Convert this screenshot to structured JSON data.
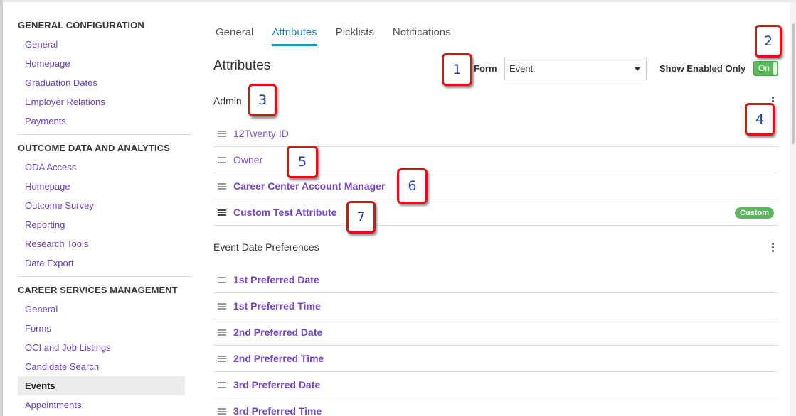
{
  "sidebar": {
    "sections": [
      {
        "title": "GENERAL CONFIGURATION",
        "items": [
          "General",
          "Homepage",
          "Graduation Dates",
          "Employer Relations",
          "Payments"
        ]
      },
      {
        "title": "OUTCOME DATA AND ANALYTICS",
        "items": [
          "ODA Access",
          "Homepage",
          "Outcome Survey",
          "Reporting",
          "Research Tools",
          "Data Export"
        ]
      },
      {
        "title": "CAREER SERVICES MANAGEMENT",
        "items": [
          "General",
          "Forms",
          "OCI and Job Listings",
          "Candidate Search",
          "Events",
          "Appointments"
        ]
      }
    ]
  },
  "tabs": [
    "General",
    "Attributes",
    "Picklists",
    "Notifications"
  ],
  "heading": "Attributes",
  "form": {
    "label": "Form",
    "value": "Event"
  },
  "show_enabled": {
    "label": "Show Enabled Only",
    "state": "On"
  },
  "groups": [
    {
      "title": "Admin",
      "rows": [
        {
          "label": "12Twenty ID",
          "bold": false,
          "badge": ""
        },
        {
          "label": "Owner",
          "bold": false,
          "badge": ""
        },
        {
          "label": "Career Center Account Manager",
          "bold": true,
          "badge": ""
        },
        {
          "label": "Custom Test Attribute",
          "bold": true,
          "badge": "Custom"
        }
      ]
    },
    {
      "title": "Event Date Preferences",
      "rows": [
        {
          "label": "1st Preferred Date",
          "bold": true,
          "badge": ""
        },
        {
          "label": "1st Preferred Time",
          "bold": true,
          "badge": ""
        },
        {
          "label": "2nd Preferred Date",
          "bold": true,
          "badge": ""
        },
        {
          "label": "2nd Preferred Time",
          "bold": true,
          "badge": ""
        },
        {
          "label": "3rd Preferred Date",
          "bold": true,
          "badge": ""
        },
        {
          "label": "3rd Preferred Time",
          "bold": true,
          "badge": ""
        }
      ]
    }
  ],
  "callouts": [
    "1",
    "2",
    "3",
    "4",
    "5",
    "6",
    "7"
  ],
  "colors": {
    "accent": "#1c9ac7",
    "link": "#7b4fc6",
    "toggle_on": "#5cb85c",
    "callout_border": "#e01010"
  }
}
